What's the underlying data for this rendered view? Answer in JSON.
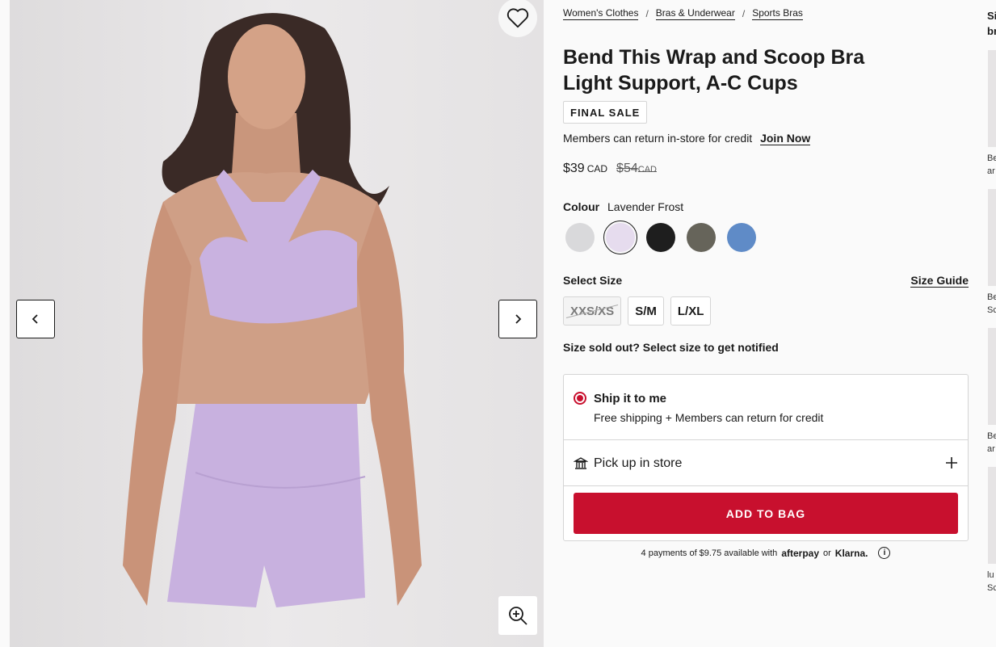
{
  "gallery": {
    "favorite_icon": "heart-icon",
    "prev_icon": "chevron-left-icon",
    "next_icon": "chevron-right-icon",
    "zoom_icon": "zoom-in-icon"
  },
  "breadcrumb": [
    {
      "label": "Women's Clothes"
    },
    {
      "label": "Bras & Underwear"
    },
    {
      "label": "Sports Bras"
    }
  ],
  "breadcrumb_sep": "/",
  "product": {
    "title_line1": "Bend This Wrap and Scoop Bra",
    "title_line2": "Light Support, A-C Cups",
    "badge": "FINAL SALE",
    "members_text": "Members can return in-store for credit",
    "join_label": "Join Now",
    "price": "$39",
    "price_currency": "CAD",
    "old_price": "$54",
    "old_currency": "CAD"
  },
  "colour": {
    "label": "Colour",
    "selected_name": "Lavender Frost",
    "swatches": [
      {
        "name": "light-grey",
        "color": "#d9d9db"
      },
      {
        "name": "lavender-frost",
        "color": "#e6dcee"
      },
      {
        "name": "black",
        "color": "#1e1e1e"
      },
      {
        "name": "olive-grey",
        "color": "#66645a"
      },
      {
        "name": "blue",
        "color": "#5f8bc7"
      }
    ]
  },
  "size": {
    "label": "Select Size",
    "guide_label": "Size Guide",
    "options": [
      {
        "label": "XXS/XS",
        "sold_out": true
      },
      {
        "label": "S/M",
        "sold_out": false
      },
      {
        "label": "L/XL",
        "sold_out": false
      }
    ],
    "sold_out_message": "Size sold out? Select size to get notified"
  },
  "fulfillment": {
    "ship_title": "Ship it to me",
    "ship_sub": "Free shipping + Members can return for credit",
    "pickup_title": "Pick up in store",
    "pickup_icon": "store-icon",
    "expand_icon": "plus-icon"
  },
  "cta": {
    "add_to_bag": "ADD TO BAG"
  },
  "paylater": {
    "text": "4 payments of $9.75 available with",
    "afterpay": "afterpay",
    "or": "or",
    "klarna": "Klarna.",
    "info_icon": "info-icon"
  },
  "rail": {
    "heading": "Si br",
    "items": [
      "Be ar",
      "Be Sc",
      "Be ar",
      "lu Sc"
    ]
  },
  "colors": {
    "accent": "#c8102e",
    "text": "#1a1a1a"
  }
}
